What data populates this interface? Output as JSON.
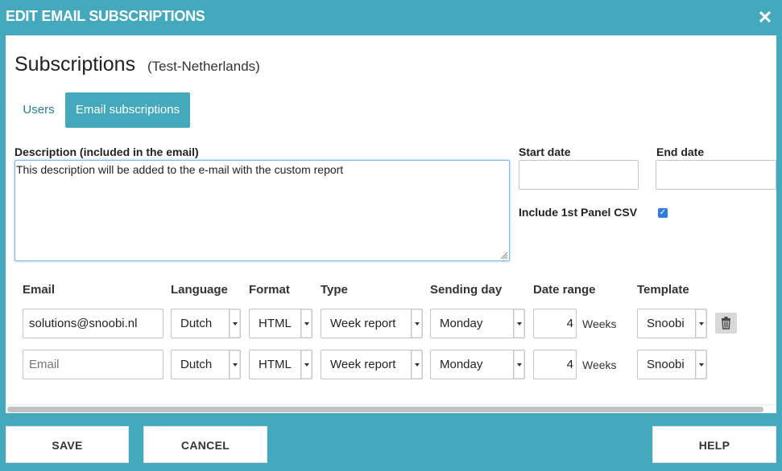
{
  "dialog": {
    "title": "EDIT EMAIL SUBSCRIPTIONS",
    "close_icon": "close-icon"
  },
  "heading": {
    "title": "Subscriptions",
    "subtitle": "(Test-Netherlands)"
  },
  "tabs": [
    {
      "label": "Users",
      "active": false
    },
    {
      "label": "Email subscriptions",
      "active": true
    }
  ],
  "form": {
    "description_label": "Description (included in the email)",
    "description_value": "This description will be added to the e-mail with the custom report",
    "start_date_label": "Start date",
    "start_date_value": "",
    "end_date_label": "End date",
    "end_date_value": "",
    "csv_label": "Include 1st Panel CSV",
    "csv_checked": true
  },
  "table": {
    "headers": [
      "Email",
      "Language",
      "Format",
      "Type",
      "Sending day",
      "Date range",
      "Template"
    ],
    "rows": [
      {
        "email": "solutions@snoobi.nl",
        "language": "Dutch",
        "format": "HTML",
        "type": "Week report",
        "day": "Monday",
        "range": "4",
        "unit": "Weeks",
        "template": "Snoobi",
        "deletable": true
      },
      {
        "email": "",
        "email_placeholder": "Email",
        "language": "Dutch",
        "format": "HTML",
        "type": "Week report",
        "day": "Monday",
        "range": "4",
        "unit": "Weeks",
        "template": "Snoobi",
        "deletable": false
      }
    ]
  },
  "footer": {
    "save": "SAVE",
    "cancel": "CANCEL",
    "help": "HELP"
  },
  "colors": {
    "accent": "#45a9bd",
    "link": "#1f7f93",
    "checkbox": "#2f7de1"
  }
}
